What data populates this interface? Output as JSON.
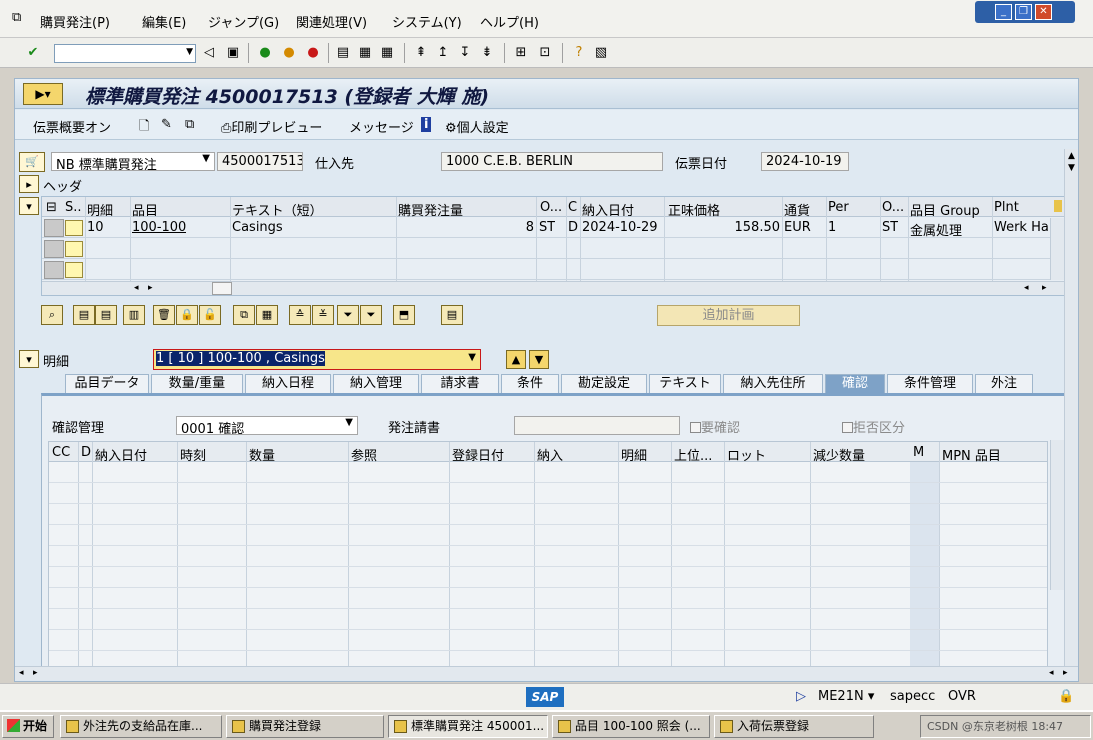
{
  "menu": {
    "items": [
      "購買発注(P)",
      "編集(E)",
      "ジャンプ(G)",
      "関連処理(V)",
      "システム(Y)",
      "ヘルプ(H)"
    ]
  },
  "window_controls": [
    "minimize",
    "restore",
    "close"
  ],
  "toolbar": {
    "command_value": "",
    "icons": [
      "enter-icon",
      "save-icon",
      "back-icon",
      "exit-icon",
      "cancel-icon",
      "print-icon",
      "find-icon",
      "find-next-icon",
      "first-page-icon",
      "previous-page-icon",
      "next-page-icon",
      "last-page-icon",
      "new-session-icon",
      "shortcut-icon",
      "help-icon",
      "layout-icon"
    ]
  },
  "title": "標準購買発注 4500017513 (登録者 大輝 施)",
  "app_toolbar": {
    "overview": "伝票概要オン",
    "print_preview": "印刷プレビュー",
    "messages": "メッセージ",
    "personal_settings": "個人設定"
  },
  "header": {
    "doc_type": "NB 標準購買発注",
    "po_number": "4500017513",
    "vendor_label": "仕入先",
    "vendor_value": "1000 C.E.B. BERLIN",
    "doc_date_label": "伝票日付",
    "doc_date_value": "2024-10-19",
    "header_label": "ヘッダ"
  },
  "item_grid": {
    "columns": [
      "S..",
      "明細",
      "品目",
      "テキスト（短）",
      "購買発注量",
      "O...",
      "C",
      "納入日付",
      "正味価格",
      "通貨",
      "Per",
      "O...",
      "品目 Group",
      "Plnt"
    ],
    "rows": [
      {
        "item": "10",
        "material": "100-100",
        "text": "Casings",
        "qty": "8",
        "unit": "ST",
        "cat": "D",
        "date": "2024-10-29",
        "price": "158.50",
        "currency": "EUR",
        "per": "1",
        "unit2": "ST",
        "group": "金属処理",
        "plant": "Werk Ham"
      }
    ]
  },
  "additional_planning": "追加計画",
  "item_detail": {
    "label": "明細",
    "selected": "1 [ 10 ] 100-100 , Casings"
  },
  "tabs": [
    "品目データ",
    "数量/重量",
    "納入日程",
    "納入管理",
    "請求書",
    "条件",
    "勘定設定",
    "テキスト",
    "納入先住所",
    "確認",
    "条件管理",
    "外注"
  ],
  "active_tab": "確認",
  "confirmation": {
    "control_label": "確認管理",
    "control_value": "0001 確認",
    "ack_label": "発注請書",
    "ack_value": "",
    "ack_required": "要確認",
    "rejection": "拒否区分",
    "columns": [
      "CC",
      "D",
      "納入日付",
      "時刻",
      "数量",
      "参照",
      "登録日付",
      "納入",
      "明細",
      "上位...",
      "ロット",
      "減少数量",
      "M",
      "MPN 品目"
    ]
  },
  "status": {
    "transaction": "ME21N",
    "server": "sapecc",
    "mode": "OVR"
  },
  "taskbar": {
    "start": "开始",
    "tasks": [
      "外注先の支給品在庫...",
      "購買発注登録",
      "標準購買発注 450001...",
      "品目 100-100 照会 (...",
      "入荷伝票登録"
    ],
    "tray": "CSDN @东京老树根 18:47"
  }
}
